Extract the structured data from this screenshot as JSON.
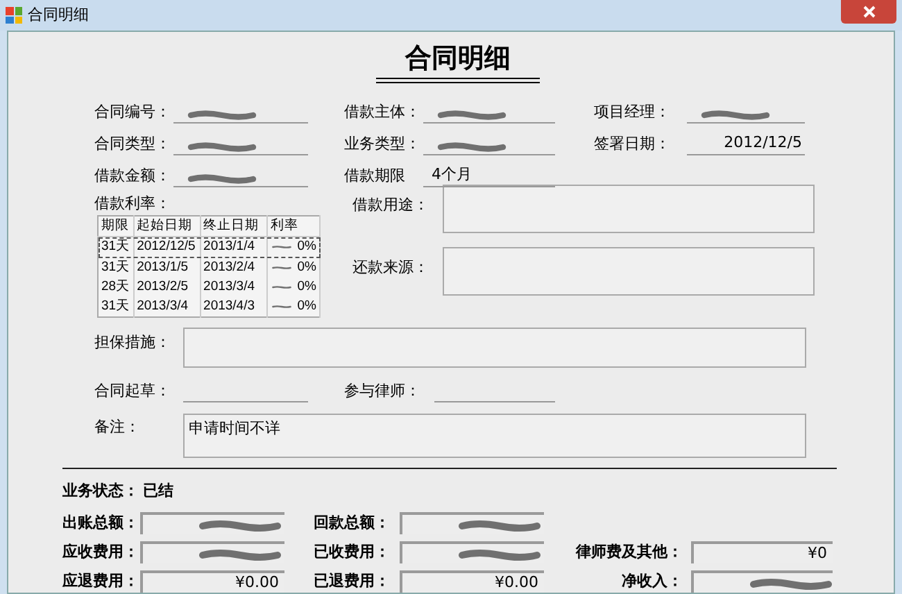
{
  "window": {
    "title": "合同明细"
  },
  "heading": "合同明细",
  "info_rows": [
    [
      {
        "label": "合同编号：",
        "redacted": true
      },
      {
        "label": "借款主体：",
        "redacted": true
      },
      {
        "label": "项目经理：",
        "redacted": true
      }
    ],
    [
      {
        "label": "合同类型：",
        "redacted": true
      },
      {
        "label": "业务类型：",
        "redacted": true
      },
      {
        "label": "签署日期：",
        "value": "2012/12/5",
        "redacted": false
      }
    ],
    [
      {
        "label": "借款金额：",
        "redacted": true
      },
      {
        "label": "借款期限",
        "value": "4个月",
        "redacted": false
      }
    ]
  ],
  "rate": {
    "label": "借款利率：",
    "columns": [
      "期限",
      "起始日期",
      "终止日期",
      "利率"
    ],
    "rows": [
      {
        "cells": [
          "31天",
          "2012/12/5",
          "2013/1/4",
          "0%"
        ],
        "selected": true
      },
      {
        "cells": [
          "31天",
          "2013/1/5",
          "2013/2/4",
          "0%"
        ],
        "selected": false
      },
      {
        "cells": [
          "28天",
          "2013/2/5",
          "2013/3/4",
          "0%"
        ],
        "selected": false
      },
      {
        "cells": [
          "31天",
          "2013/3/4",
          "2013/4/3",
          "0%"
        ],
        "selected": false
      }
    ]
  },
  "purpose": {
    "label": "借款用途："
  },
  "source": {
    "label": "还款来源："
  },
  "guarantee": {
    "label": "担保措施："
  },
  "drafter": {
    "label": "合同起草："
  },
  "lawyer": {
    "label": "参与律师："
  },
  "remark": {
    "label": "备注：",
    "value": "申请时间不详"
  },
  "status": {
    "label": "业务状态：",
    "value": "已结"
  },
  "money_rows": [
    [
      {
        "label": "出账总额：",
        "redacted": true
      },
      {
        "label": "回款总额：",
        "redacted": true
      }
    ],
    [
      {
        "label": "应收费用：",
        "redacted": true
      },
      {
        "label": "已收费用：",
        "redacted": true
      },
      {
        "label": "律师费及其他：",
        "value": "¥0",
        "redacted": false
      }
    ],
    [
      {
        "label": "应退费用：",
        "value": "¥0.00",
        "redacted": false
      },
      {
        "label": "已退费用：",
        "value": "¥0.00",
        "redacted": false
      },
      {
        "label": "净收入：",
        "redacted": true
      }
    ]
  ]
}
